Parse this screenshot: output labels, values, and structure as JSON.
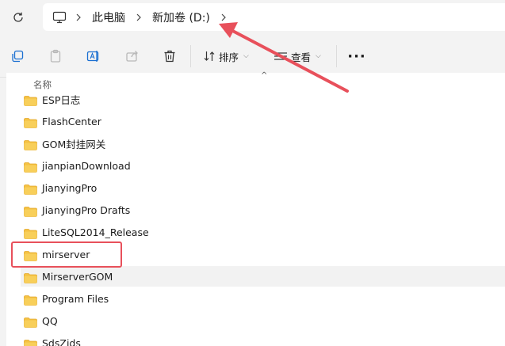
{
  "address_bar": {
    "refresh_icon": "refresh-icon",
    "pc_icon": "computer-icon",
    "breadcrumbs": [
      {
        "label": "此电脑"
      },
      {
        "label": "新加卷 (D:)"
      }
    ]
  },
  "toolbar": {
    "icons": [
      "new-item-icon",
      "copy-icon",
      "rename-icon",
      "share-icon",
      "delete-icon"
    ],
    "sort_label": "排序",
    "view_label": "查看",
    "more_label": "···"
  },
  "file_list": {
    "column_name": "名称",
    "items": [
      {
        "name": "ESP日志"
      },
      {
        "name": "FlashCenter"
      },
      {
        "name": "GOM封挂网关"
      },
      {
        "name": "jianpianDownload"
      },
      {
        "name": "JianyingPro"
      },
      {
        "name": "JianyingPro Drafts"
      },
      {
        "name": "LiteSQL2014_Release"
      },
      {
        "name": "mirserver"
      },
      {
        "name": "MirserverGOM"
      },
      {
        "name": "Program Files"
      },
      {
        "name": "QQ"
      },
      {
        "name": "SdsZids"
      }
    ]
  },
  "colors": {
    "folder": "#f5c243",
    "folder_dark": "#e4a92b",
    "annotation": "#e8505b",
    "hover_row": "#f2f2f2"
  }
}
